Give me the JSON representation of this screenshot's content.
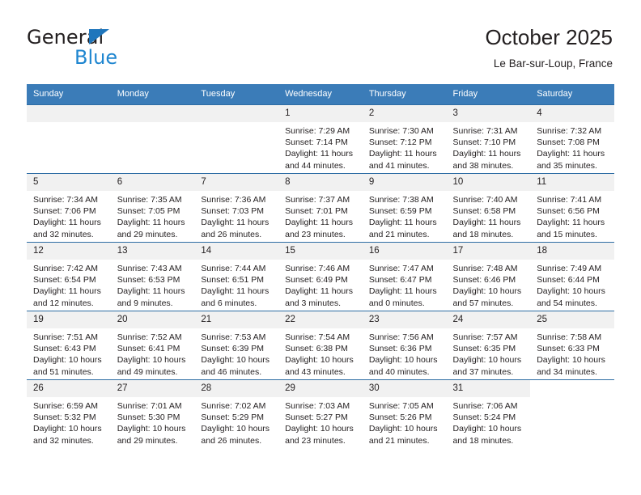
{
  "brand": {
    "name_primary": "General",
    "name_secondary": "Blue",
    "logo_icon": "triangle-icon",
    "accent_color": "#1f86d0"
  },
  "header": {
    "title": "October 2025",
    "subtitle": "Le Bar-sur-Loup, France"
  },
  "colors": {
    "header_row_bg": "#3b7cb8",
    "row_divider": "#2e6da4",
    "daynum_bg": "#f1f1f1",
    "text": "#231f20"
  },
  "calendar": {
    "weekday_headers": [
      "Sunday",
      "Monday",
      "Tuesday",
      "Wednesday",
      "Thursday",
      "Friday",
      "Saturday"
    ],
    "weeks": [
      [
        {
          "day": "",
          "blank": true
        },
        {
          "day": "",
          "blank": true
        },
        {
          "day": "",
          "blank": true
        },
        {
          "day": "1",
          "sunrise": "Sunrise: 7:29 AM",
          "sunset": "Sunset: 7:14 PM",
          "daylight": "Daylight: 11 hours and 44 minutes."
        },
        {
          "day": "2",
          "sunrise": "Sunrise: 7:30 AM",
          "sunset": "Sunset: 7:12 PM",
          "daylight": "Daylight: 11 hours and 41 minutes."
        },
        {
          "day": "3",
          "sunrise": "Sunrise: 7:31 AM",
          "sunset": "Sunset: 7:10 PM",
          "daylight": "Daylight: 11 hours and 38 minutes."
        },
        {
          "day": "4",
          "sunrise": "Sunrise: 7:32 AM",
          "sunset": "Sunset: 7:08 PM",
          "daylight": "Daylight: 11 hours and 35 minutes."
        }
      ],
      [
        {
          "day": "5",
          "sunrise": "Sunrise: 7:34 AM",
          "sunset": "Sunset: 7:06 PM",
          "daylight": "Daylight: 11 hours and 32 minutes."
        },
        {
          "day": "6",
          "sunrise": "Sunrise: 7:35 AM",
          "sunset": "Sunset: 7:05 PM",
          "daylight": "Daylight: 11 hours and 29 minutes."
        },
        {
          "day": "7",
          "sunrise": "Sunrise: 7:36 AM",
          "sunset": "Sunset: 7:03 PM",
          "daylight": "Daylight: 11 hours and 26 minutes."
        },
        {
          "day": "8",
          "sunrise": "Sunrise: 7:37 AM",
          "sunset": "Sunset: 7:01 PM",
          "daylight": "Daylight: 11 hours and 23 minutes."
        },
        {
          "day": "9",
          "sunrise": "Sunrise: 7:38 AM",
          "sunset": "Sunset: 6:59 PM",
          "daylight": "Daylight: 11 hours and 21 minutes."
        },
        {
          "day": "10",
          "sunrise": "Sunrise: 7:40 AM",
          "sunset": "Sunset: 6:58 PM",
          "daylight": "Daylight: 11 hours and 18 minutes."
        },
        {
          "day": "11",
          "sunrise": "Sunrise: 7:41 AM",
          "sunset": "Sunset: 6:56 PM",
          "daylight": "Daylight: 11 hours and 15 minutes."
        }
      ],
      [
        {
          "day": "12",
          "sunrise": "Sunrise: 7:42 AM",
          "sunset": "Sunset: 6:54 PM",
          "daylight": "Daylight: 11 hours and 12 minutes."
        },
        {
          "day": "13",
          "sunrise": "Sunrise: 7:43 AM",
          "sunset": "Sunset: 6:53 PM",
          "daylight": "Daylight: 11 hours and 9 minutes."
        },
        {
          "day": "14",
          "sunrise": "Sunrise: 7:44 AM",
          "sunset": "Sunset: 6:51 PM",
          "daylight": "Daylight: 11 hours and 6 minutes."
        },
        {
          "day": "15",
          "sunrise": "Sunrise: 7:46 AM",
          "sunset": "Sunset: 6:49 PM",
          "daylight": "Daylight: 11 hours and 3 minutes."
        },
        {
          "day": "16",
          "sunrise": "Sunrise: 7:47 AM",
          "sunset": "Sunset: 6:47 PM",
          "daylight": "Daylight: 11 hours and 0 minutes."
        },
        {
          "day": "17",
          "sunrise": "Sunrise: 7:48 AM",
          "sunset": "Sunset: 6:46 PM",
          "daylight": "Daylight: 10 hours and 57 minutes."
        },
        {
          "day": "18",
          "sunrise": "Sunrise: 7:49 AM",
          "sunset": "Sunset: 6:44 PM",
          "daylight": "Daylight: 10 hours and 54 minutes."
        }
      ],
      [
        {
          "day": "19",
          "sunrise": "Sunrise: 7:51 AM",
          "sunset": "Sunset: 6:43 PM",
          "daylight": "Daylight: 10 hours and 51 minutes."
        },
        {
          "day": "20",
          "sunrise": "Sunrise: 7:52 AM",
          "sunset": "Sunset: 6:41 PM",
          "daylight": "Daylight: 10 hours and 49 minutes."
        },
        {
          "day": "21",
          "sunrise": "Sunrise: 7:53 AM",
          "sunset": "Sunset: 6:39 PM",
          "daylight": "Daylight: 10 hours and 46 minutes."
        },
        {
          "day": "22",
          "sunrise": "Sunrise: 7:54 AM",
          "sunset": "Sunset: 6:38 PM",
          "daylight": "Daylight: 10 hours and 43 minutes."
        },
        {
          "day": "23",
          "sunrise": "Sunrise: 7:56 AM",
          "sunset": "Sunset: 6:36 PM",
          "daylight": "Daylight: 10 hours and 40 minutes."
        },
        {
          "day": "24",
          "sunrise": "Sunrise: 7:57 AM",
          "sunset": "Sunset: 6:35 PM",
          "daylight": "Daylight: 10 hours and 37 minutes."
        },
        {
          "day": "25",
          "sunrise": "Sunrise: 7:58 AM",
          "sunset": "Sunset: 6:33 PM",
          "daylight": "Daylight: 10 hours and 34 minutes."
        }
      ],
      [
        {
          "day": "26",
          "sunrise": "Sunrise: 6:59 AM",
          "sunset": "Sunset: 5:32 PM",
          "daylight": "Daylight: 10 hours and 32 minutes."
        },
        {
          "day": "27",
          "sunrise": "Sunrise: 7:01 AM",
          "sunset": "Sunset: 5:30 PM",
          "daylight": "Daylight: 10 hours and 29 minutes."
        },
        {
          "day": "28",
          "sunrise": "Sunrise: 7:02 AM",
          "sunset": "Sunset: 5:29 PM",
          "daylight": "Daylight: 10 hours and 26 minutes."
        },
        {
          "day": "29",
          "sunrise": "Sunrise: 7:03 AM",
          "sunset": "Sunset: 5:27 PM",
          "daylight": "Daylight: 10 hours and 23 minutes."
        },
        {
          "day": "30",
          "sunrise": "Sunrise: 7:05 AM",
          "sunset": "Sunset: 5:26 PM",
          "daylight": "Daylight: 10 hours and 21 minutes."
        },
        {
          "day": "31",
          "sunrise": "Sunrise: 7:06 AM",
          "sunset": "Sunset: 5:24 PM",
          "daylight": "Daylight: 10 hours and 18 minutes."
        },
        {
          "day": "",
          "blank": true
        }
      ]
    ]
  }
}
